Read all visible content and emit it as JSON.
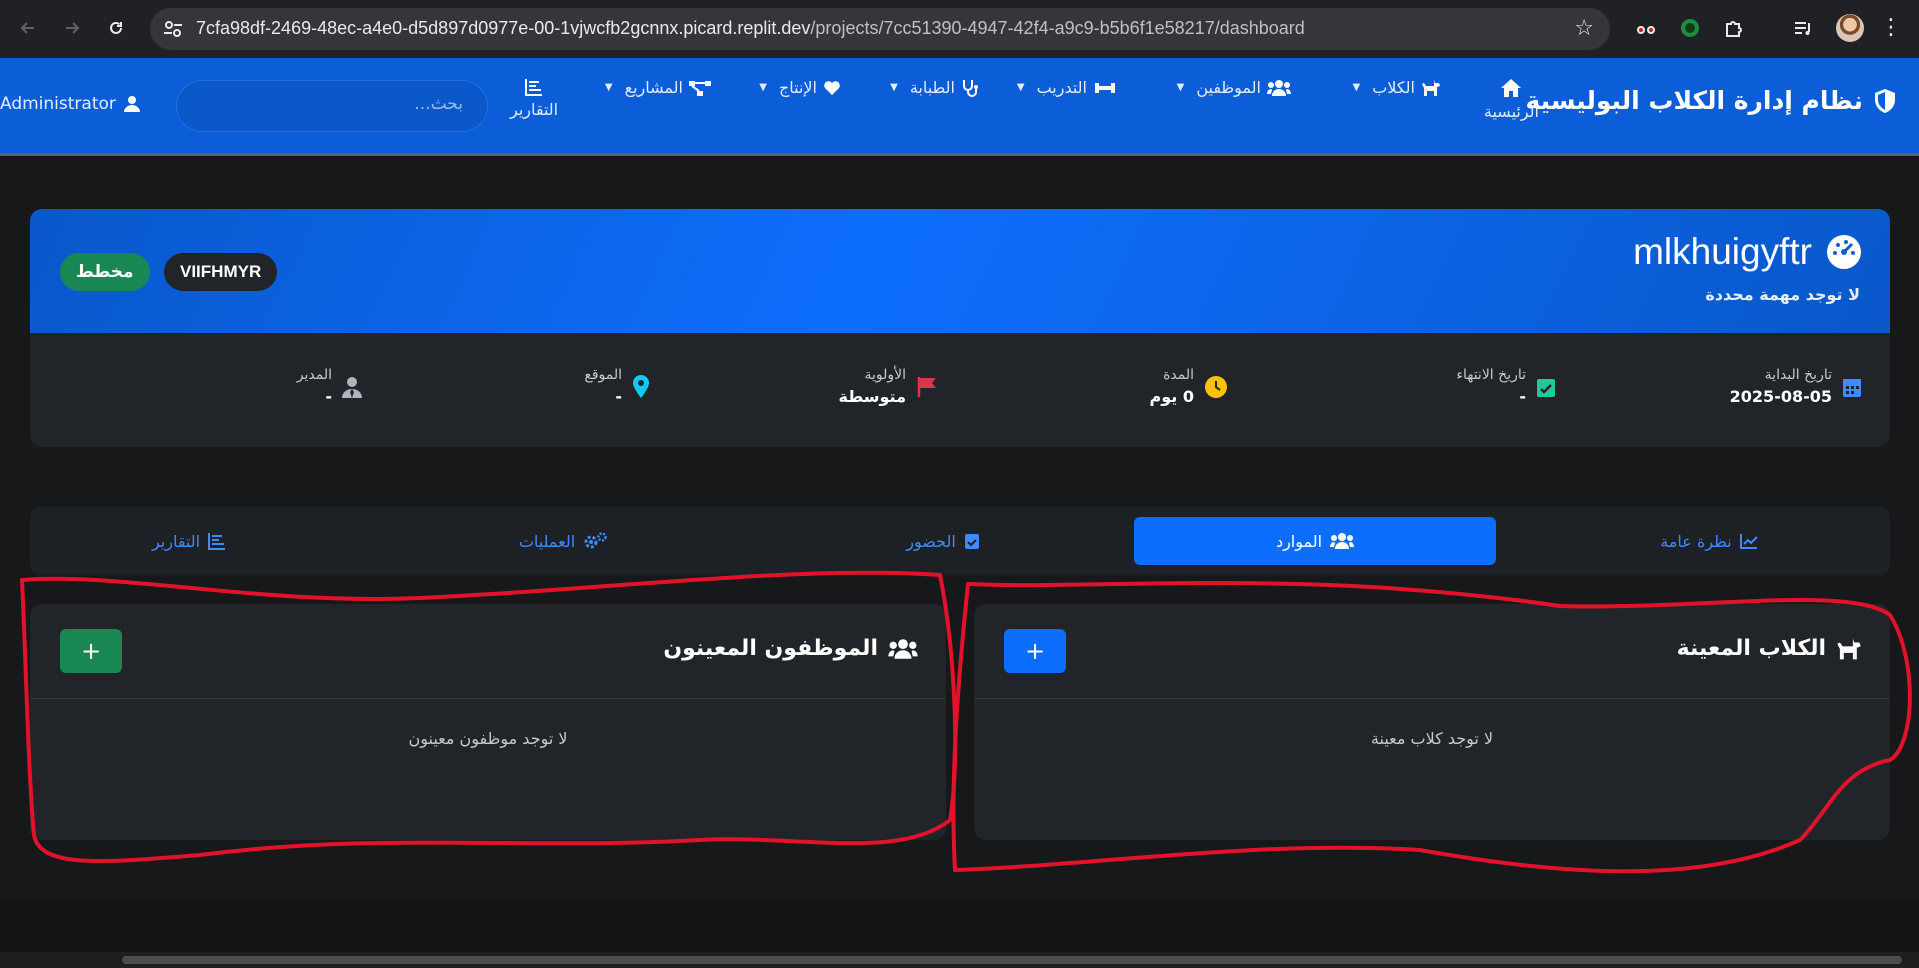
{
  "browser": {
    "url_host": "7cfa98df-2469-48ec-a4e0-d5d897d0977e-00-1vjwcfb2gcnnx.picard.replit.dev",
    "url_path": "/projects/7cc51390-4947-42f4-a9c9-b5b6f1e58217/dashboard"
  },
  "navbar": {
    "brand": "نظام إدارة الكلاب البوليسية",
    "home": "الرئيسية",
    "dogs": "الكلاب",
    "employees": "الموظفين",
    "training": "التدريب",
    "veterinary": "الطبابة",
    "production": "الإنتاج",
    "projects": "المشاريع",
    "reports": "التقارير",
    "search_placeholder": "بحث...",
    "admin": "Administrator"
  },
  "project": {
    "title": "mlkhuigyftr",
    "subtitle": "لا توجد مهمة محددة",
    "code": "VIIFHMYR",
    "status": "مخطط",
    "meta": {
      "start_label": "تاريخ البداية",
      "start_value": "2025-08-05",
      "end_label": "تاريخ الانتهاء",
      "end_value": "-",
      "duration_label": "المدة",
      "duration_value": "0 يوم",
      "priority_label": "الأولوية",
      "priority_value": "متوسطة",
      "location_label": "الموقع",
      "location_value": "-",
      "manager_label": "المدير",
      "manager_value": "-"
    }
  },
  "tabs": {
    "overview": "نظرة عامة",
    "resources": "الموارد",
    "attendance": "الحضور",
    "operations": "العمليات",
    "reports": "التقارير"
  },
  "panels": {
    "dogs_title": "الكلاب المعينة",
    "dogs_add": "+",
    "dogs_empty": "لا توجد كلاب معينة",
    "staff_title": "الموظفون المعينون",
    "staff_add": "+",
    "staff_empty": "لا توجد موظفون معينون"
  },
  "colors": {
    "primary": "#0d6efd",
    "success": "#198754",
    "annotation": "#e3122b"
  }
}
